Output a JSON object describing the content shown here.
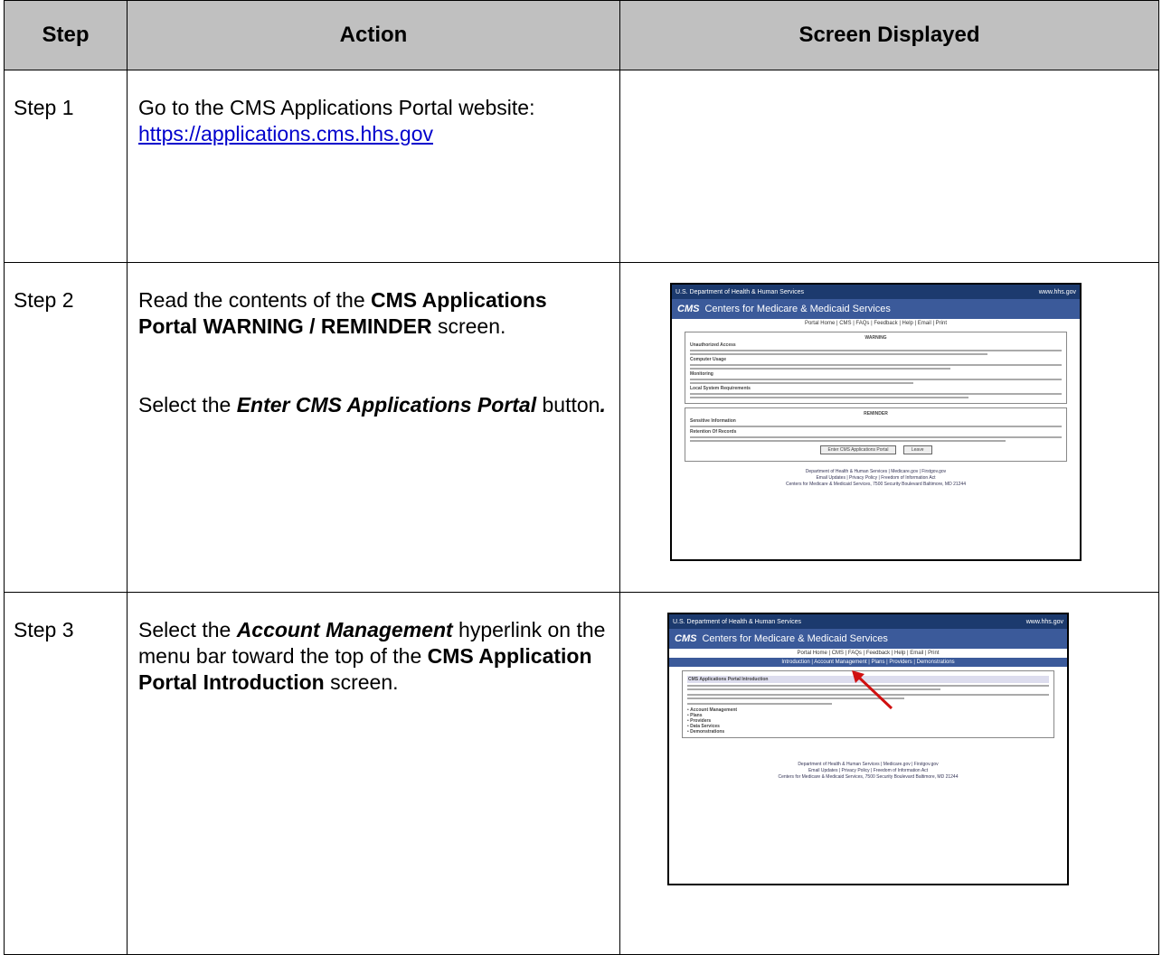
{
  "headers": {
    "step": "Step",
    "action": "Action",
    "screen": "Screen Displayed"
  },
  "rows": [
    {
      "step": "Step 1",
      "line1": "Go to the CMS Applications Portal website:",
      "link": "https://applications.cms.hhs.gov"
    },
    {
      "step": "Step 2",
      "p1_pre": "Read the contents of the ",
      "p1_bold": "CMS Applications Portal WARNING / REMINDER",
      "p1_post": " screen.",
      "p2_pre": "Select the ",
      "p2_bold": "Enter CMS Applications Portal",
      "p2_post": " button",
      "p2_end": "."
    },
    {
      "step": "Step 3",
      "p1_pre": "Select the ",
      "p1_bold": "Account Management",
      "p1_mid": " hyperlink on the menu bar toward the top of the ",
      "p1_bold2": "CMS Application Portal Introduction",
      "p1_post": " screen."
    }
  ],
  "shot2": {
    "topbar_left": "U.S. Department of Health & Human Services",
    "topbar_right": "www.hhs.gov",
    "logo": "CMS",
    "banner": "Centers for Medicare & Medicaid Services",
    "nav": "Portal Home | CMS | FAQs | Feedback | Help | Email | Print",
    "warning_title": "WARNING",
    "reminder_title": "REMINDER",
    "sec1": "Unauthorized Access",
    "sec2": "Computer Usage",
    "sec3": "Monitoring",
    "sec4": "Local System Requirements",
    "sec5": "Sensitive Information",
    "sec6": "Retention Of Records",
    "btn_enter": "Enter CMS Applications Portal",
    "btn_leave": "Leave",
    "foot1": "Department of Health & Human Services | Medicare.gov | Firstgov.gov",
    "foot2": "Email Updates | Privacy Policy | Freedom of Information Act",
    "foot3": "Centers for Medicare & Medicaid Services, 7500 Security Boulevard Baltimore, MD 21244"
  },
  "shot3": {
    "topbar_left": "U.S. Department of Health & Human Services",
    "topbar_right": "www.hhs.gov",
    "logo": "CMS",
    "banner": "Centers for Medicare & Medicaid Services",
    "nav": "Portal Home | CMS | FAQs | Feedback | Help | Email | Print",
    "menu": "Introduction | Account Management | Plans | Providers | Demonstrations",
    "panel_title": "CMS Applications Portal Introduction",
    "b1": "Account Management",
    "b2": "Plans",
    "b3": "Providers",
    "b4": "Data Services",
    "b5": "Demonstrations",
    "foot1": "Department of Health & Human Services | Medicare.gov | Firstgov.gov",
    "foot2": "Email Updates | Privacy Policy | Freedom of Information Act",
    "foot3": "Centers for Medicare & Medicaid Services, 7500 Security Boulevard Baltimore, MD 21244"
  }
}
